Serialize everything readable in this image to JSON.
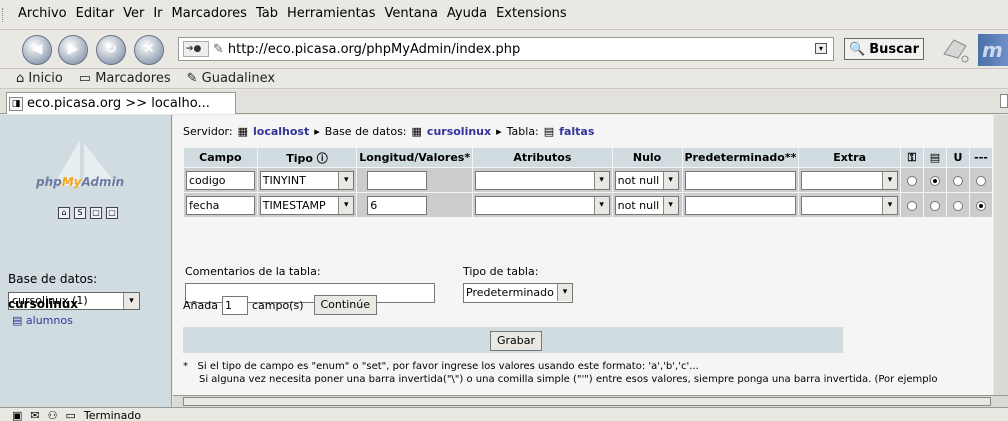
{
  "menu": [
    "Archivo",
    "Editar",
    "Ver",
    "Ir",
    "Marcadores",
    "Tab",
    "Herramientas",
    "Ventana",
    "Ayuda",
    "Extensions"
  ],
  "url": "http://eco.picasa.org/phpMyAdmin/index.php",
  "search_label": "Buscar",
  "bookmarks": [
    "Inicio",
    "Marcadores",
    "Guadalinex"
  ],
  "tab_title": "eco.picasa.org >> localho...",
  "left": {
    "logo_php": "php",
    "logo_my": "My",
    "logo_admin": "Admin",
    "db_label": "Base de datos:",
    "db_selected": "cursolinux (1)",
    "db_name": "cursolinux",
    "table_link": "alumnos"
  },
  "breadcrumb": {
    "server_label": "Servidor:",
    "server": "localhost",
    "db_label": "Base de datos:",
    "db": "cursolinux",
    "table_label": "Tabla:",
    "table": "faltas"
  },
  "columns": [
    "Campo",
    "Tipo",
    "Longitud/Valores*",
    "Atributos",
    "Nulo",
    "Predeterminado**",
    "Extra",
    "---"
  ],
  "rows": [
    {
      "campo": "codigo",
      "tipo": "TINYINT",
      "longitud": "",
      "atributos": "",
      "nulo": "not null",
      "pred": "",
      "extra": "",
      "radio": 1
    },
    {
      "campo": "fecha",
      "tipo": "TIMESTAMP",
      "longitud": "6",
      "atributos": "",
      "nulo": "not null",
      "pred": "",
      "extra": "",
      "radio": 3
    }
  ],
  "comments_label": "Comentarios de la tabla:",
  "table_type_label": "Tipo de tabla:",
  "table_type_value": "Predeterminado",
  "add_prefix": "Añada",
  "add_value": "1",
  "add_suffix": "campo(s)",
  "continue_label": "Continúe",
  "save_label": "Grabar",
  "note_1": "Si el tipo de campo es \"enum\" o \"set\", por favor ingrese los valores usando este formato: 'a','b','c'...",
  "note_2": "Si alguna vez necesita poner una barra invertida(\"\\\") o una comilla simple (\"'\") entre esos valores, siempre ponga una barra invertida. (Por ejemplo",
  "status": "Terminado"
}
